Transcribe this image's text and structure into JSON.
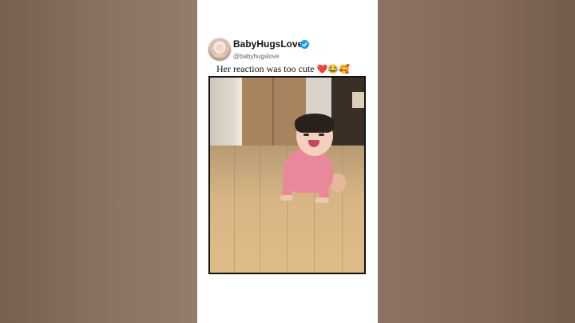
{
  "post": {
    "username": "BabyHugsLove",
    "handle": "@babyhugslove",
    "caption_text": "Her reaction was too cute ",
    "caption_emojis": "❤️😂🥰"
  },
  "icons": {
    "verified": "verified-badge-icon",
    "avatar": "avatar-icon"
  },
  "colors": {
    "verified": "#1d9bf0",
    "card_background": "#ffffff",
    "side_background": "#8d7766"
  }
}
